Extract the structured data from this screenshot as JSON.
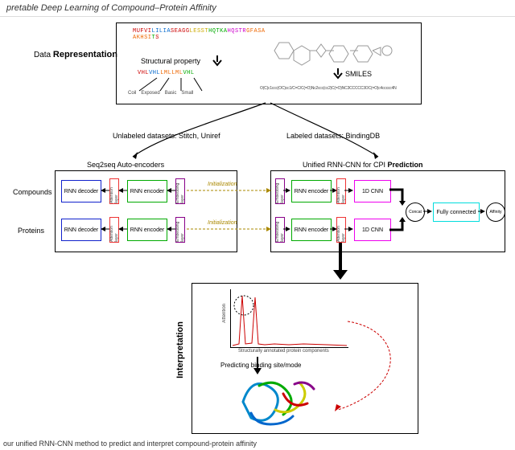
{
  "header": {
    "title": "pretable Deep Learning of Compound–Protein Affinity"
  },
  "sections": {
    "data_rep_prefix": "Data ",
    "data_rep_bold": "Representation",
    "struct_prop": "Structural property",
    "smiles": "SMILES",
    "contact_labels": [
      "Coil",
      "Exposed",
      "Basic",
      "Small"
    ]
  },
  "datasets": {
    "unlabeled": "Unlabeled datasets: Stitch, Uniref",
    "labeled": "Labeled datasets: BindingDB"
  },
  "panels": {
    "seq2seq": "Seq2seq Auto-encoders",
    "unified_prefix": "Unified RNN-CNN for CPI ",
    "unified_bold": "Prediction"
  },
  "rows": {
    "compounds": "Compounds",
    "proteins": "Proteins"
  },
  "blocks": {
    "rnn_decoder": "RNN decoder",
    "rnn_encoder": "RNN encoder",
    "attention": "Attention layer",
    "embedding": "Embedding layer",
    "cnn": "1D CNN",
    "concat": "Concat",
    "fully_conn": "Fully connected",
    "affinity": "Affinity",
    "init": "Initialization"
  },
  "interpretation": {
    "section": "Interpretation",
    "ylabel": "Attention",
    "xlabel": "Structurally annotated protein components",
    "binding": "Predicting binding site/mode"
  },
  "footer": {
    "caption": "our unified RNN-CNN method to predict and interpret compound-protein affinity"
  }
}
